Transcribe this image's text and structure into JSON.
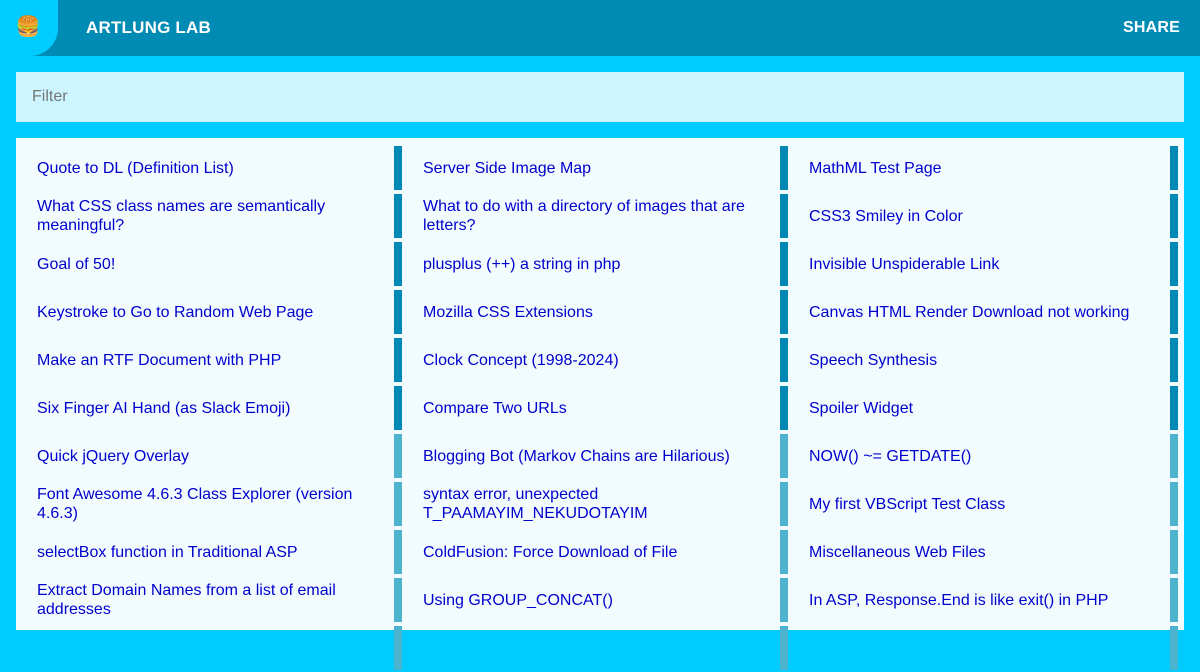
{
  "header": {
    "menu_icon": "🍔",
    "menu_icon_name": "hamburger-icon",
    "brand": "ARTLUNG LAB",
    "share_label": "SHARE"
  },
  "filter": {
    "placeholder": "Filter",
    "value": ""
  },
  "colors": {
    "header_bg": "#008bb5",
    "accent": "#00ccff",
    "filter_bg": "#ccf5ff",
    "list_bg": "#f2fcff",
    "link": "#0000cc",
    "bar_dark": "#0089b3",
    "bar_light": "#4db3cf"
  },
  "links": [
    "Quote to DL (Definition List)",
    "Server Side Image Map",
    "MathML Test Page",
    "What CSS class names are semantically meaningful?",
    "What to do with a directory of images that are letters?",
    "CSS3 Smiley in Color",
    "Goal of 50!",
    "plusplus (++) a string in php",
    "Invisible Unspiderable Link",
    "Keystroke to Go to Random Web Page",
    "Mozilla CSS Extensions",
    "Canvas HTML Render Download not working",
    "Make an RTF Document with PHP",
    "Clock Concept (1998-2024)",
    "Speech Synthesis",
    "Six Finger AI Hand (as Slack Emoji)",
    "Compare Two URLs",
    "Spoiler Widget",
    "Quick jQuery Overlay",
    "Blogging Bot (Markov Chains are Hilarious)",
    "NOW() ~= GETDATE()",
    "Font Awesome 4.6.3 Class Explorer (version 4.6.3)",
    "syntax error, unexpected T_PAAMAYIM_NEKUDOTAYIM",
    "My first VBScript Test Class",
    "selectBox function in Traditional ASP",
    "ColdFusion: Force Download of File",
    "Miscellaneous Web Files",
    "Extract Domain Names from a list of email addresses",
    "Using GROUP_CONCAT()",
    "In ASP, Response.End is like exit() in PHP",
    "",
    "",
    ""
  ]
}
